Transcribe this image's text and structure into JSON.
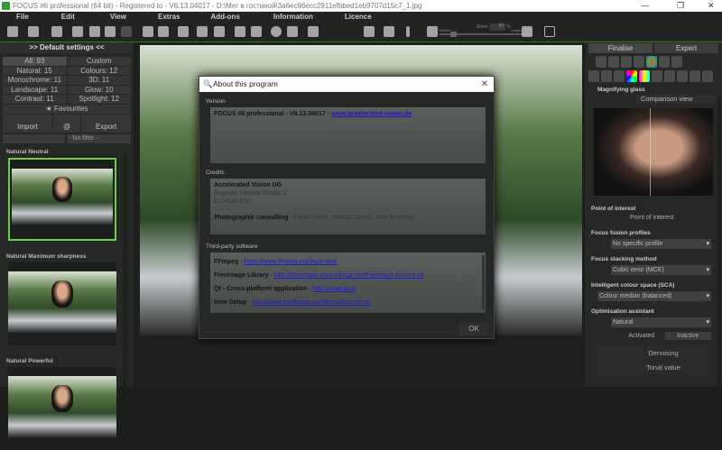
{
  "window": {
    "title": "FOCUS #6 professional (64 bit) - Registered to - V6.13.04017 - D:\\Мег в гостиной\\3a6ec86ecc2911efbbed1eb9707d15c7_1.jpg",
    "minimize": "—",
    "maximize": "❐",
    "close": "✕"
  },
  "menu": [
    "File",
    "Edit",
    "View",
    "Extras",
    "Add-ons",
    "Information",
    "Licence"
  ],
  "toolbar": {
    "zoom_label": "Zoom",
    "zoom_value": "88",
    "zoom_unit": "%",
    "smaller": "Smaller",
    "larger": "Larger",
    "zoom_slider": 0.15
  },
  "left": {
    "header": ">> Default settings <<",
    "filters": [
      [
        "All: 93",
        "Custom"
      ],
      [
        "Natural: 15",
        "Colours: 12"
      ],
      [
        "Monochrome: 11",
        "3D: 11"
      ],
      [
        "Landscape: 11",
        "Glow: 10"
      ],
      [
        "Contrast: 11",
        "Spotlight: 12"
      ]
    ],
    "favourites": "★ Favourites",
    "import": "Import",
    "at": "@",
    "export": "Export",
    "filter_select": "- No filter -",
    "presets": [
      "Natural Neutral",
      "Natural Maximum sharpness",
      "Natural Powerful"
    ]
  },
  "dialog": {
    "title": "About this program",
    "version_label": "Version",
    "version_text": "FOCUS #6 professional - V6.13.04017 - ",
    "version_link": "www.accelerated-vision.de",
    "credits_label": "Credits",
    "company": "Accelerated Vision UG",
    "street": "Auguste-Viktoria-Straße 2",
    "city": "D-24103 Kiel",
    "consult_label": "Photographic consulting",
    "consult_names": " - Falko Sieker, Markus Janes, Uwe Benecke",
    "third_label": "Third-party software",
    "third": [
      {
        "name": "FFmpeg",
        "link": "https://www.ffmpeg.org/legal.html"
      },
      {
        "name": "FreeImage Library",
        "link": "http://freeimage.sourceforge.net/freeimage-license.txt"
      },
      {
        "name": "Qt - Cross-platform application",
        "link": "http://www.qt.io"
      },
      {
        "name": "Inno Setup",
        "link": "http://www.jrsoftware.org/files/is/license.txt"
      }
    ],
    "ok": "OK"
  },
  "right": {
    "tabs": [
      "Finalise",
      "Expert"
    ],
    "magnifier": "Magnifying glass",
    "comparison": "Comparison view",
    "poi_label": "Point of interest",
    "poi_button": "Point of interest",
    "ffp_label": "Focus fusion profiles",
    "ffp_value": "No specific profile",
    "fsm_label": "Focus stacking method",
    "fsm_value": "Cubic error (MCE)",
    "sca_label": "Intelligent colour space (SCA)",
    "sca_value": "Colour median (balanced)",
    "opt_label": "Optimisation assistant",
    "opt_value": "Natural",
    "activated": "Activated",
    "inactive": "Inactive",
    "denoising": "Denoising",
    "tonal": "Tonal value"
  }
}
